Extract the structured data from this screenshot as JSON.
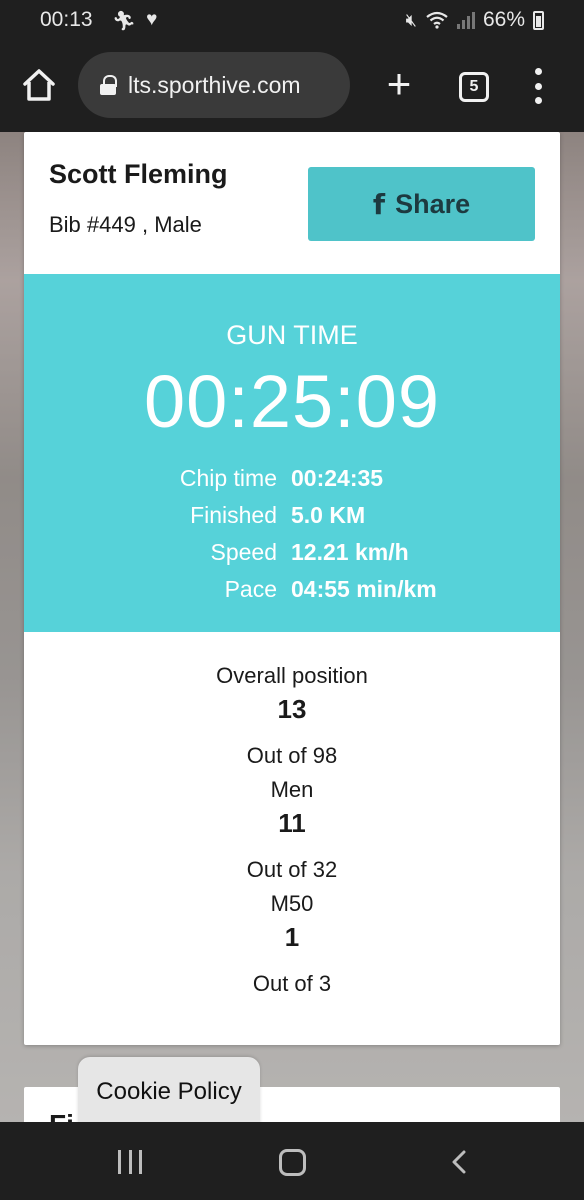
{
  "status_bar": {
    "time": "00:13",
    "left_icons": [
      "notification-icon",
      "heart-icon"
    ],
    "battery_percent": "66%",
    "right_icons": [
      "mute-icon",
      "wifi-icon",
      "signal-icon",
      "battery-icon"
    ]
  },
  "browser": {
    "url": "lts.sporthive.com",
    "tab_count": "5",
    "new_tab_label": "+"
  },
  "athlete": {
    "name": "Scott Fleming",
    "meta": "Bib #449 , Male",
    "share_label": "Share",
    "share_icon": "f"
  },
  "result": {
    "gun_label": "GUN TIME",
    "gun_time": "00:25:09",
    "stats": [
      {
        "label": "Chip time",
        "value": "00:24:35"
      },
      {
        "label": "Finished",
        "value": "5.0 KM"
      },
      {
        "label": "Speed",
        "value": "12.21 km/h"
      },
      {
        "label": "Pace",
        "value": "04:55 min/km"
      }
    ]
  },
  "positions": [
    {
      "label": "Overall position",
      "value": "13",
      "out_of": "Out of 98"
    },
    {
      "label": "Men",
      "value": "11",
      "out_of": "Out of 32"
    },
    {
      "label": "M50",
      "value": "1",
      "out_of": "Out of 3"
    }
  ],
  "second_card": {
    "title": "Fi"
  },
  "cookie": {
    "label": "Cookie Policy"
  },
  "colors": {
    "accent": "#56d2d9",
    "share_button": "#4fc3c9",
    "system_bar": "#1f1f1f"
  }
}
